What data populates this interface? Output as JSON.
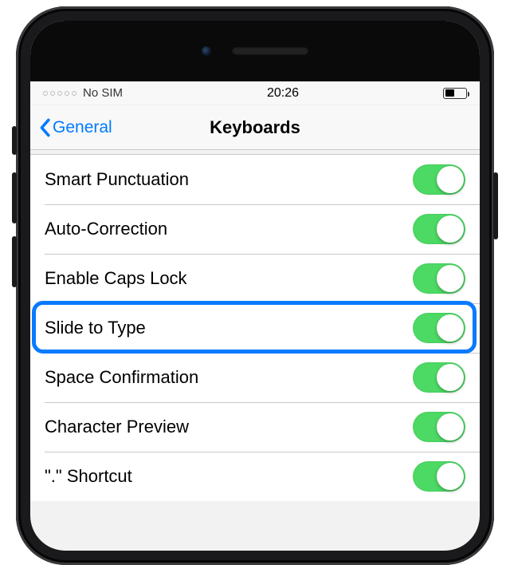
{
  "status": {
    "carrier": "No SIM",
    "time": "20:26"
  },
  "navbar": {
    "back_label": "General",
    "title": "Keyboards"
  },
  "rows": [
    {
      "label": "Smart Punctuation",
      "on": true
    },
    {
      "label": "Auto-Correction",
      "on": true
    },
    {
      "label": "Enable Caps Lock",
      "on": true
    },
    {
      "label": "Slide to Type",
      "on": true,
      "highlighted": true
    },
    {
      "label": "Space Confirmation",
      "on": true
    },
    {
      "label": "Character Preview",
      "on": true
    },
    {
      "label": "\".\" Shortcut",
      "on": true
    }
  ]
}
